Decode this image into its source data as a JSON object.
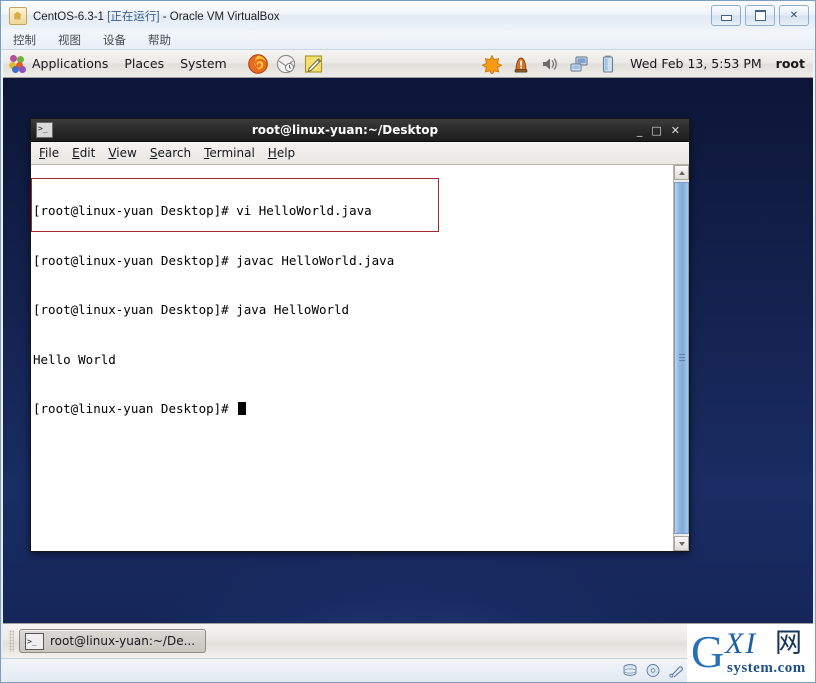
{
  "vbox": {
    "title_vm": "CentOS-6.3-1",
    "title_state": "[正在运行]",
    "title_app": "- Oracle VM VirtualBox",
    "title_full": "CentOS-6.3-1 [正在运行] - Oracle VM VirtualBox",
    "window_buttons": [
      {
        "name": "minimize",
        "glyph": ""
      },
      {
        "name": "maximize",
        "glyph": ""
      },
      {
        "name": "close",
        "glyph": "✕"
      }
    ],
    "menus": [
      {
        "label": "控制"
      },
      {
        "label": "视图"
      },
      {
        "label": "设备"
      },
      {
        "label": "帮助"
      }
    ],
    "statusbar_icons": [
      "hard-disk-icon",
      "cd-dvd-icon",
      "usb-icon",
      "network-icon",
      "shared-folders-icon",
      "video-capture-icon",
      "mouse-integration-icon",
      "host-key-icon"
    ]
  },
  "gnome_panel": {
    "apps_menu": "Applications",
    "places_menu": "Places",
    "system_menu": "System",
    "launchers": [
      "firefox-icon",
      "email-icon",
      "text-editor-icon"
    ],
    "tray_icons": [
      "updates-icon",
      "alert-icon",
      "volume-icon",
      "network-icon",
      "battery-icon"
    ],
    "clock": "Wed Feb 13,  5:53 PM",
    "user": "root"
  },
  "terminal": {
    "title": "root@linux-yuan:~/Desktop",
    "window_buttons": [
      {
        "name": "minimize",
        "glyph": "_"
      },
      {
        "name": "maximize",
        "glyph": "□"
      },
      {
        "name": "close",
        "glyph": "✕"
      }
    ],
    "menus": [
      {
        "label": "File",
        "mnemonic": "F",
        "rest": "ile"
      },
      {
        "label": "Edit",
        "mnemonic": "E",
        "rest": "dit"
      },
      {
        "label": "View",
        "mnemonic": "V",
        "rest": "iew"
      },
      {
        "label": "Search",
        "mnemonic": "S",
        "rest": "earch"
      },
      {
        "label": "Terminal",
        "mnemonic": "T",
        "rest": "erminal"
      },
      {
        "label": "Help",
        "mnemonic": "H",
        "rest": "elp"
      }
    ],
    "prompt": "[root@linux-yuan Desktop]# ",
    "lines": [
      "[root@linux-yuan Desktop]# vi HelloWorld.java",
      "[root@linux-yuan Desktop]# javac HelloWorld.java",
      "[root@linux-yuan Desktop]# java HelloWorld",
      "Hello World",
      "[root@linux-yuan Desktop]# "
    ],
    "annotation_color": "#9e2b2b",
    "scrollbar": {
      "position": "top",
      "thumb_fraction": 0.97
    }
  },
  "bottom_panel": {
    "task_label": "root@linux-yuan:~/De...",
    "workspaces": 4,
    "active_workspace": 1
  },
  "watermark": {
    "g": "G",
    "xi": "XI",
    "cn": "网",
    "domain": "system.com"
  }
}
